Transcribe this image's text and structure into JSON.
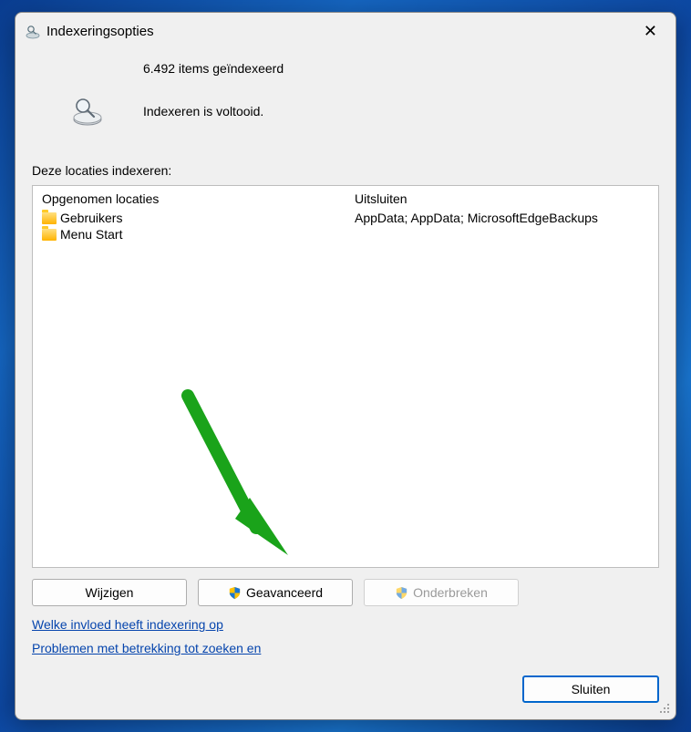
{
  "title": "Indexeringsopties",
  "status": {
    "count_line": "6.492 items geïndexeerd",
    "complete_line": "Indexeren is voltooid."
  },
  "section_label": "Deze locaties indexeren:",
  "columns": {
    "included_header": "Opgenomen locaties",
    "excluded_header": "Uitsluiten",
    "included": [
      "Gebruikers",
      "Menu Start"
    ],
    "excluded": [
      "AppData; AppData; MicrosoftEdgeBackups"
    ]
  },
  "buttons": {
    "modify": "Wijzigen",
    "advanced": "Geavanceerd",
    "pause": "Onderbreken",
    "close": "Sluiten"
  },
  "links": {
    "influence": "Welke invloed heeft indexering op",
    "troubleshoot": "Problemen met betrekking tot zoeken en"
  }
}
